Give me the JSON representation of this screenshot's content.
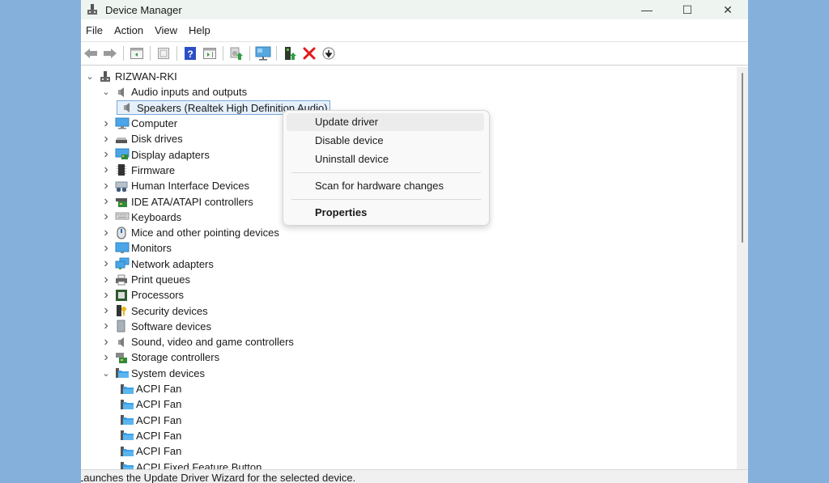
{
  "window": {
    "title": "Device Manager",
    "controls": {
      "minimize": "—",
      "maximize": "☐",
      "close": "✕"
    }
  },
  "menubar": {
    "items": [
      "File",
      "Action",
      "View",
      "Help"
    ]
  },
  "toolbar": {
    "buttons": [
      {
        "name": "back",
        "icon": "back-arrow-icon"
      },
      {
        "name": "forward",
        "icon": "forward-arrow-icon"
      },
      {
        "name": "show-hide-console-tree",
        "icon": "console-tree-icon"
      },
      {
        "name": "properties",
        "icon": "properties-icon"
      },
      {
        "name": "help",
        "icon": "help-icon"
      },
      {
        "name": "show-action-pane",
        "icon": "action-pane-icon"
      },
      {
        "name": "update-driver",
        "icon": "update-driver-icon"
      },
      {
        "name": "scan-hardware",
        "icon": "scan-hardware-icon"
      },
      {
        "name": "add-legacy-hardware",
        "icon": "add-hardware-icon"
      },
      {
        "name": "uninstall-device",
        "icon": "uninstall-x-icon"
      },
      {
        "name": "disable-device",
        "icon": "disable-device-icon"
      }
    ]
  },
  "tree": {
    "root": {
      "label": "RIZWAN-RKI",
      "expanded": true
    },
    "nodes": [
      {
        "label": "Audio inputs and outputs",
        "level": 1,
        "expanded": true,
        "icon": "speaker-icon"
      },
      {
        "label": "Speakers (Realtek High Definition Audio)",
        "level": 2,
        "selected": true,
        "icon": "speaker-icon"
      },
      {
        "label": "Computer",
        "level": 1,
        "expanded": false,
        "icon": "computer-icon"
      },
      {
        "label": "Disk drives",
        "level": 1,
        "expanded": false,
        "icon": "disk-drive-icon"
      },
      {
        "label": "Display adapters",
        "level": 1,
        "expanded": false,
        "icon": "display-adapter-icon"
      },
      {
        "label": "Firmware",
        "level": 1,
        "expanded": false,
        "icon": "firmware-chip-icon"
      },
      {
        "label": "Human Interface Devices",
        "level": 1,
        "expanded": false,
        "icon": "hid-icon"
      },
      {
        "label": "IDE ATA/ATAPI controllers",
        "level": 1,
        "expanded": false,
        "icon": "ide-controller-icon"
      },
      {
        "label": "Keyboards",
        "level": 1,
        "expanded": false,
        "icon": "keyboard-icon"
      },
      {
        "label": "Mice and other pointing devices",
        "level": 1,
        "expanded": false,
        "icon": "mouse-icon"
      },
      {
        "label": "Monitors",
        "level": 1,
        "expanded": false,
        "icon": "monitor-icon"
      },
      {
        "label": "Network adapters",
        "level": 1,
        "expanded": false,
        "icon": "network-adapter-icon"
      },
      {
        "label": "Print queues",
        "level": 1,
        "expanded": false,
        "icon": "printer-icon"
      },
      {
        "label": "Processors",
        "level": 1,
        "expanded": false,
        "icon": "processor-icon"
      },
      {
        "label": "Security devices",
        "level": 1,
        "expanded": false,
        "icon": "security-device-icon"
      },
      {
        "label": "Software devices",
        "level": 1,
        "expanded": false,
        "icon": "software-device-icon"
      },
      {
        "label": "Sound, video and game controllers",
        "level": 1,
        "expanded": false,
        "icon": "speaker-icon"
      },
      {
        "label": "Storage controllers",
        "level": 1,
        "expanded": false,
        "icon": "storage-controller-icon"
      },
      {
        "label": "System devices",
        "level": 1,
        "expanded": true,
        "icon": "system-folder-icon"
      },
      {
        "label": "ACPI Fan",
        "level": 2,
        "icon": "system-folder-icon"
      },
      {
        "label": "ACPI Fan",
        "level": 2,
        "icon": "system-folder-icon"
      },
      {
        "label": "ACPI Fan",
        "level": 2,
        "icon": "system-folder-icon"
      },
      {
        "label": "ACPI Fan",
        "level": 2,
        "icon": "system-folder-icon"
      },
      {
        "label": "ACPI Fan",
        "level": 2,
        "icon": "system-folder-icon"
      },
      {
        "label": "ACPI Fixed Feature Button",
        "level": 2,
        "icon": "system-folder-icon"
      }
    ]
  },
  "context_menu": {
    "items": [
      {
        "label": "Update driver",
        "hover": true
      },
      {
        "label": "Disable device"
      },
      {
        "label": "Uninstall device"
      },
      {
        "separator": true
      },
      {
        "label": "Scan for hardware changes"
      },
      {
        "separator": true
      },
      {
        "label": "Properties",
        "bold": true
      }
    ]
  },
  "statusbar": {
    "text": "Launches the Update Driver Wizard for the selected device."
  },
  "colors": {
    "desktop": "#85b0dc",
    "titlebar": "#eef5f1",
    "selection_border": "#7aa7d9",
    "selection_fill": "#e5f0fb",
    "uninstall_red": "#e01b1b",
    "help_blue": "#2c4fc7"
  }
}
